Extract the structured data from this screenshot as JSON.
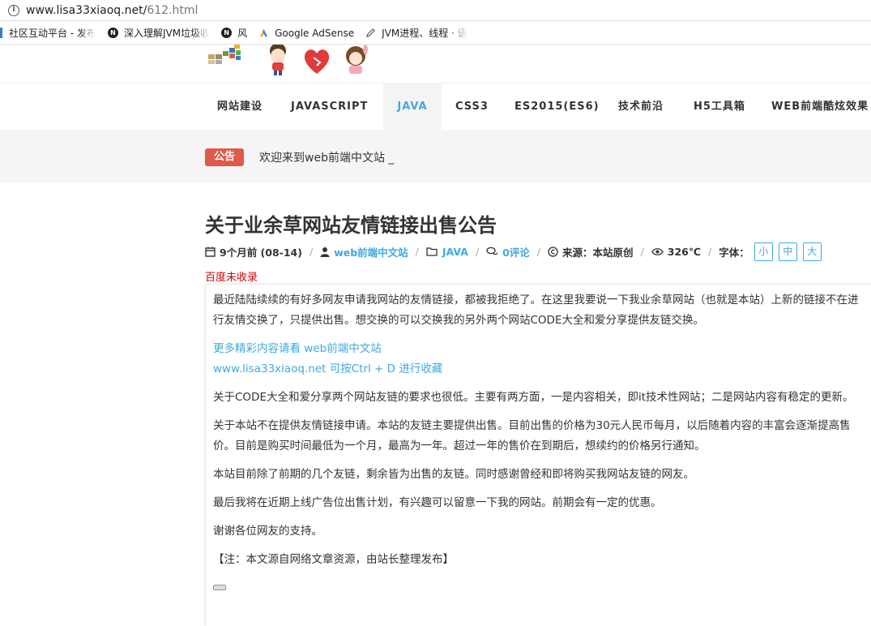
{
  "browser": {
    "url_host": "www.lisa33xiaoq.net/",
    "url_path": "612.html",
    "bookmarks": [
      {
        "label": "社区互动平台 - 发布",
        "icon": "bar-icon"
      },
      {
        "label": "深入理解JVM垃圾收",
        "icon": "n-icon"
      },
      {
        "label": "风",
        "icon": "n-icon"
      },
      {
        "label": "Google AdSense",
        "icon": "adsense-icon"
      },
      {
        "label": "JVM进程、线程 · 语",
        "icon": "pen-icon"
      }
    ]
  },
  "nav": {
    "items": [
      {
        "label": "网站建设"
      },
      {
        "label": "JAVASCRIPT"
      },
      {
        "label": "JAVA"
      },
      {
        "label": "CSS3"
      },
      {
        "label": "ES2015(ES6)"
      },
      {
        "label": "技术前沿"
      },
      {
        "label": "H5工具箱"
      },
      {
        "label": "WEB前端酷炫效果"
      }
    ],
    "active": "JAVA",
    "active_color": "#3eaadf"
  },
  "notice": {
    "badge": "公告",
    "text": "欢迎来到web前端中文站 _"
  },
  "article": {
    "title": "关于业余草网站友情链接出售公告",
    "meta": {
      "date": "9个月前 (08-14)",
      "author": "web前端中文站",
      "category": "JAVA",
      "comments": "0评论",
      "source": "来源：本站原创",
      "views": "326℃",
      "font_label": "字体：",
      "font_sizes": [
        "小",
        "中",
        "大"
      ]
    },
    "baidu_status": "百度未收录",
    "paragraphs": [
      "最近陆陆续续的有好多网友申请我网站的友情链接，都被我拒绝了。在这里我要说一下我业余草网站（也就是本站）上新的链接不在进行友情交换了，只提供出售。想交换的可以交换我的另外两个网站CODE大全和爱分享提供友链交换。",
      "关于CODE大全和爱分享两个网站友链的要求也很低。主要有两方面，一是内容相关，即it技术性网站；二是网站内容有稳定的更新。",
      "关于本站不在提供友情链接申请。本站的友链主要提供出售。目前出售的价格为30元人民币每月，以后随着内容的丰富会逐渐提高售价。目前是购买时间最低为一个月，最高为一年。超过一年的售价在到期后，想续约的价格另行通知。",
      "本站目前除了前期的几个友链，剩余皆为出售的友链。同时感谢曾经和即将购买我网站友链的网友。",
      "最后我将在近期上线广告位出售计划，有兴趣可以留意一下我的网站。前期会有一定的优惠。",
      "谢谢各位网友的支持。",
      "【注：本文源自网络文章资源，由站长整理发布】"
    ],
    "promo_line1": "更多精彩内容请看 web前端中文站",
    "promo_line2": "www.lisa33xiaoq.net 可按Ctrl + D 进行收藏"
  },
  "colors": {
    "accent": "#3eaadf",
    "notice_badge": "#e05a4c",
    "baidu_red": "#d60000"
  }
}
